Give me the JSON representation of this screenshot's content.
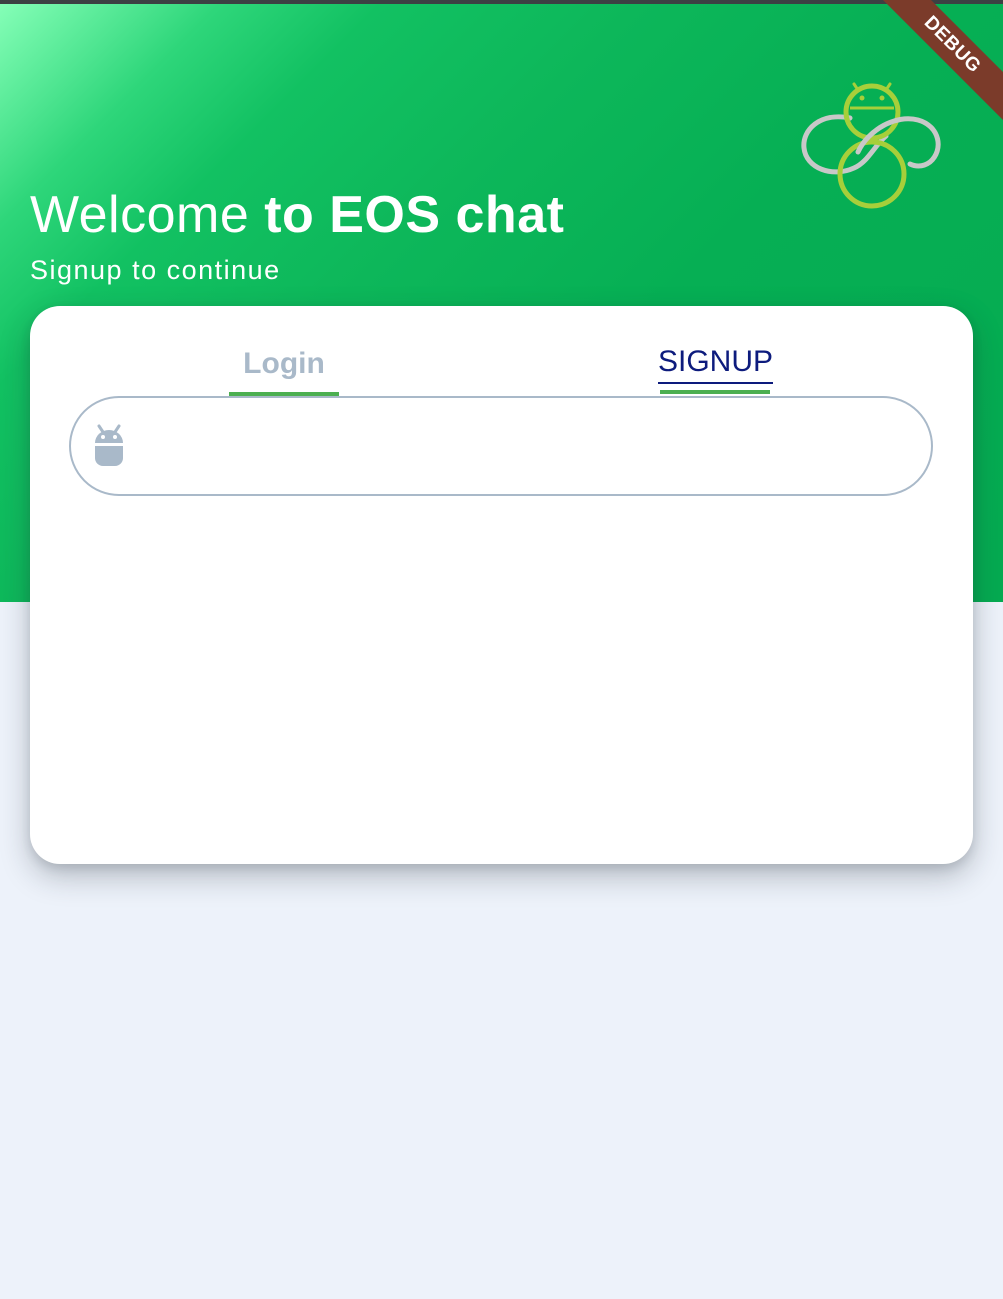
{
  "header": {
    "welcome_prefix": "Welcome ",
    "welcome_bold": "to EOS chat",
    "subtitle": "Signup to continue",
    "logo_icon": "eos-chat-logo-icon",
    "gradient_colors": [
      "#86ffb8",
      "#05ab51"
    ]
  },
  "debug_banner": {
    "label": "DEBUG",
    "color": "#7b3b2a"
  },
  "tabs": [
    {
      "label": "Login",
      "active": false,
      "color": "#a9b9c9"
    },
    {
      "label": "SIGNUP",
      "active": true,
      "color": "#0d1b7d"
    }
  ],
  "tab_indicator_color": "#4caf50",
  "form": {
    "input": {
      "icon": "android-icon",
      "value": "",
      "placeholder": "",
      "border_color": "#a9b9c9"
    }
  },
  "colors": {
    "background": "#edf2fa",
    "card": "#ffffff"
  }
}
